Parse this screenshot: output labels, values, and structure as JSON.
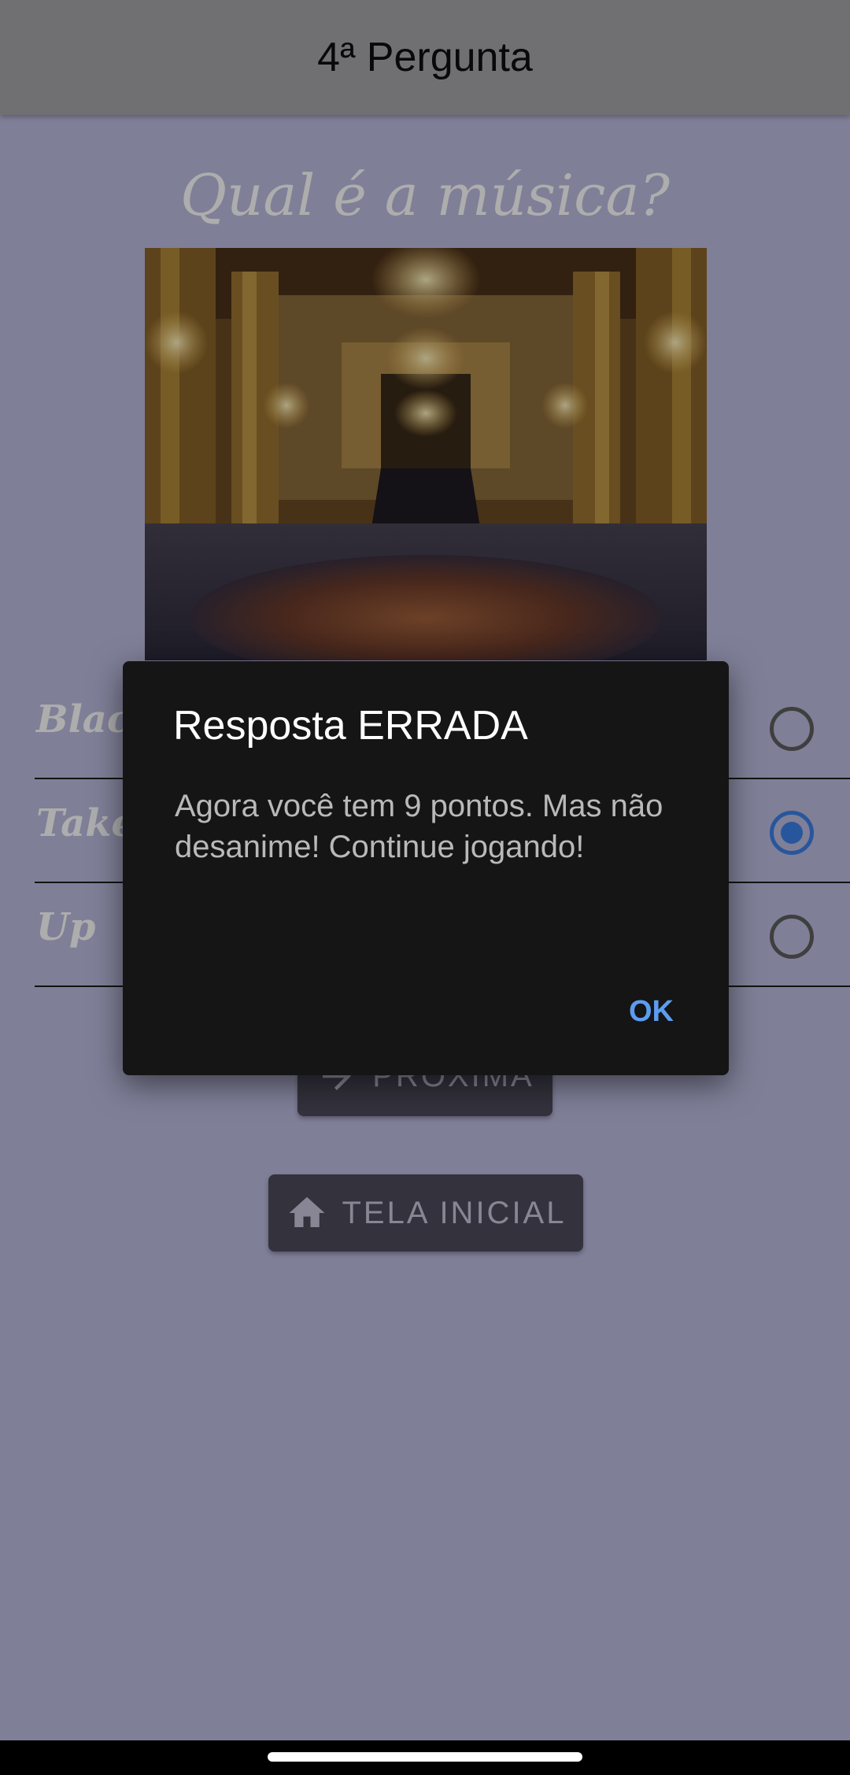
{
  "appbar": {
    "title": "4ª Pergunta"
  },
  "question": {
    "title": "Qual é a música?"
  },
  "options": [
    {
      "label": "Black",
      "selected": false
    },
    {
      "label": "Take T",
      "selected": true
    },
    {
      "label": "Up",
      "selected": false
    }
  ],
  "buttons": {
    "next_label": "PRÓXIMA",
    "home_label": "TELA INICIAL"
  },
  "dialog": {
    "title": "Resposta ERRADA",
    "message": "Agora você tem 9 pontos. Mas não desanime! Continue jogando!",
    "ok_label": "OK"
  },
  "icons": {
    "next": "arrow-right-icon",
    "home": "home-icon"
  },
  "colors": {
    "accent": "#3b7fe6",
    "ok_text": "#5c9cf0",
    "dialog_bg": "#151515"
  }
}
